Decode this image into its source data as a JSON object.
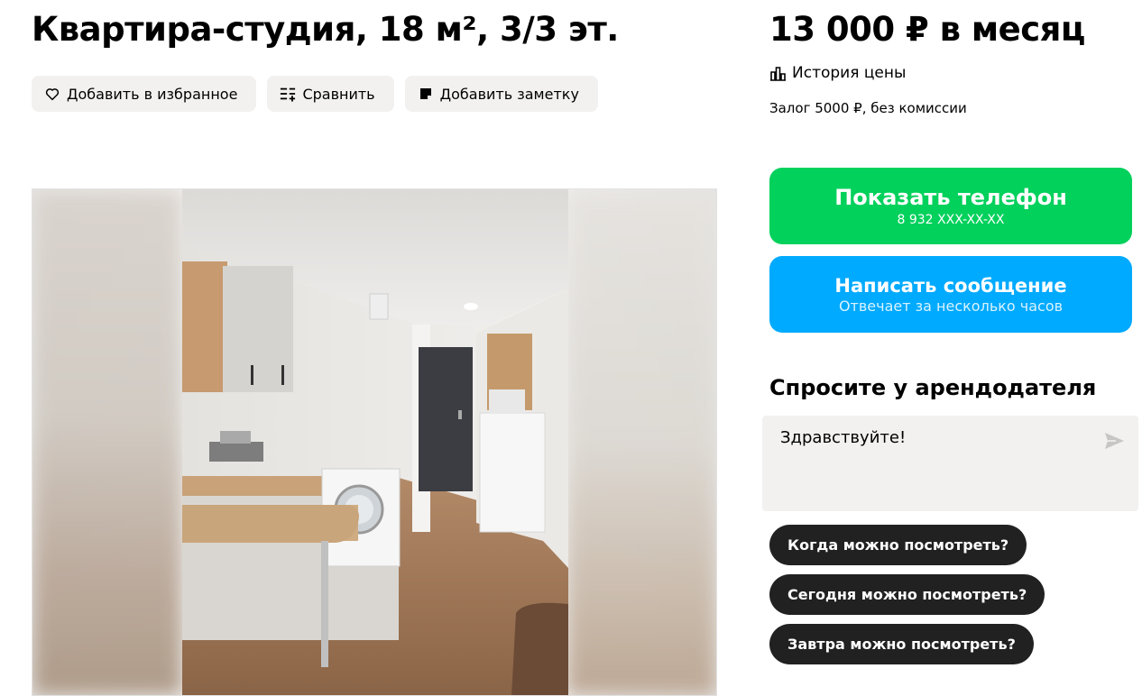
{
  "listing": {
    "title": "Квартира-студия, 18 м², 3/3 эт.",
    "actions": {
      "favorite": "Добавить в избранное",
      "compare": "Сравнить",
      "note": "Добавить заметку"
    }
  },
  "pricing": {
    "price": "13 000 ₽ в месяц",
    "history_link": "История цены",
    "deposit": "Залог 5000 ₽, без комиссии"
  },
  "contact": {
    "phone_button": {
      "label": "Показать телефон",
      "number": "8 932 XXX-XX-XX"
    },
    "message_button": {
      "label": "Написать сообщение",
      "note": "Отвечает за несколько часов"
    }
  },
  "ask": {
    "title": "Спросите у арендодателя",
    "message_value": "Здравствуйте!",
    "quick_questions": [
      "Когда можно посмотреть?",
      "Сегодня можно посмотреть?",
      "Завтра можно посмотреть?"
    ]
  },
  "colors": {
    "phone_green": "#02d15c",
    "message_blue": "#00aaff",
    "chip_dark": "#212121",
    "action_bg": "#f2f1f0"
  },
  "icons": {
    "favorite": "heart-icon",
    "compare": "compare-list-icon",
    "note": "note-icon",
    "history": "bar-chart-icon",
    "send": "send-arrow-icon"
  }
}
